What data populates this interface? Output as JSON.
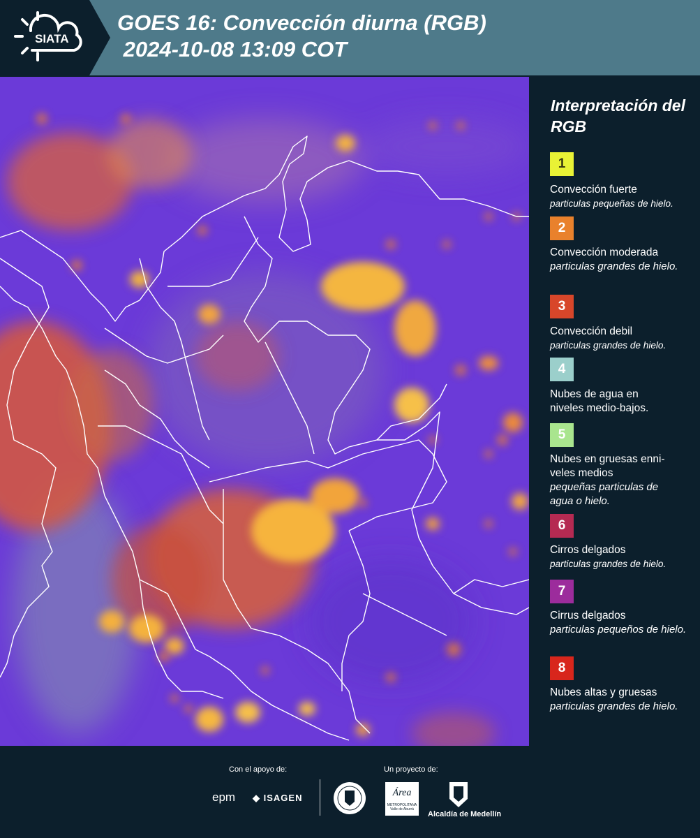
{
  "header": {
    "logo_text": "SIATA",
    "title_line1": "GOES 16: Convección diurna (RGB)",
    "title_line2": " 2024-10-08 13:09 COT"
  },
  "legend": {
    "title": "Interpretación del RGB",
    "items": [
      {
        "num": "1",
        "color": "#e9f235",
        "text_color": "#3a3a10",
        "label": "Convección fuerte",
        "sub": "particulas pequeñas de hielo."
      },
      {
        "num": "2",
        "color": "#e9812c",
        "text_color": "#ffffff",
        "label": "Convección moderada",
        "sub": "particulas grandes de hielo."
      },
      {
        "num": "3",
        "color": "#d8462a",
        "text_color": "#ffffff",
        "label": "Convección debil",
        "sub": "particulas grandes de hielo."
      },
      {
        "num": "4",
        "color": "#9bcfcb",
        "text_color": "#ffffff",
        "label": "Nubes de agua en niveles medio-bajos.",
        "sub": ""
      },
      {
        "num": "5",
        "color": "#a9e58e",
        "text_color": "#ffffff",
        "label": "Nubes en gruesas enni-veles medios",
        "sub": "pequeñas particulas de agua o hielo."
      },
      {
        "num": "6",
        "color": "#b52a52",
        "text_color": "#ffffff",
        "label": "Cirros delgados",
        "sub": "particulas grandes de hielo."
      },
      {
        "num": "7",
        "color": "#9c2c9c",
        "text_color": "#ffffff",
        "label": "Cirrus delgados",
        "sub": "particulas pequeños de hielo."
      },
      {
        "num": "8",
        "color": "#d8261c",
        "text_color": "#ffffff",
        "label": "Nubes altas y gruesas",
        "sub": "particulas grandes de hielo."
      }
    ]
  },
  "footer": {
    "support_label": "Con el apoyo de:",
    "project_label": "Un proyecto de:",
    "sponsor1": "epm",
    "sponsor2": "ISAGEN",
    "partner1": "Área",
    "partner1_sub": "METROPOLITANA Valle de Aburrá",
    "partner2": "Alcaldía de Medellín"
  },
  "map": {
    "background_color": "#6a38d8",
    "border_color": "#ffffff"
  }
}
